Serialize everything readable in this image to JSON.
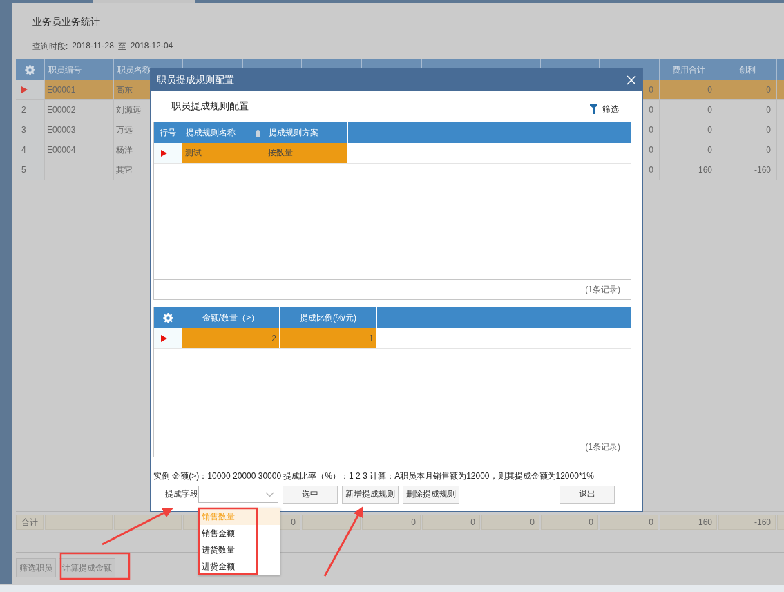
{
  "page": {
    "title": "业务员业务统计",
    "query_label": "查询时段:",
    "date_from": "2018-11-28",
    "date_sep": "至",
    "date_to": "2018-12-04"
  },
  "staff_table": {
    "columns": {
      "code": "职员编号",
      "name": "职员名称",
      "tail": [
        "费用合计",
        "创利"
      ]
    },
    "rows": [
      {
        "selected": true,
        "code": "E00001",
        "name": "高东",
        "values": [
          "0",
          "0",
          "0"
        ]
      },
      {
        "selected": false,
        "number": "2",
        "code": "E00002",
        "name": "刘源远",
        "values": [
          "0",
          "0",
          "0"
        ]
      },
      {
        "selected": false,
        "number": "3",
        "code": "E00003",
        "name": "万远",
        "values": [
          "0",
          "0",
          "0"
        ]
      },
      {
        "selected": false,
        "number": "4",
        "code": "E00004",
        "name": "杨洋",
        "values": [
          "0",
          "0",
          "0"
        ]
      },
      {
        "selected": false,
        "number": "5",
        "name": "其它",
        "values": [
          "0",
          "160",
          "-160"
        ]
      }
    ],
    "totals": {
      "label": "合计",
      "cells": [
        {},
        {},
        {},
        {
          "value": "0"
        },
        {},
        {
          "value": "0"
        },
        {
          "value": "0"
        },
        {
          "value": "0"
        },
        {
          "value": "0"
        },
        {
          "value": "0"
        },
        {
          "value": "160"
        },
        {
          "value": "-160"
        },
        {}
      ]
    }
  },
  "bottom_buttons": [
    "筛选职员",
    "计算提成金额"
  ],
  "dialog": {
    "title": "职员提成规则配置",
    "heading": "职员提成规则配置",
    "filter": "筛选",
    "rules_grid": {
      "columns": [
        {
          "label": "行号",
          "locked": false
        },
        {
          "label": "提成规则名称",
          "locked": true
        },
        {
          "label": "提成规则方案",
          "locked": false
        }
      ],
      "rows": [
        {
          "selected": true,
          "cells": [
            "",
            "测试",
            "按数量"
          ]
        }
      ],
      "footer": "(1条记录)"
    },
    "tiers_grid": {
      "columns": [
        {
          "label": "金额/数量（>）"
        },
        {
          "label": "提成比例(%/元)"
        }
      ],
      "rows": [
        {
          "selected": true,
          "cells": [
            "2",
            "1"
          ]
        }
      ],
      "footer": "(1条记录)"
    },
    "example": "实例 金额(>)：10000 20000 30000 提成比率（%）：1 2 3 计算：A职员本月销售额为12000，则其提成金额为12000*1%",
    "field_label": "提成字段",
    "field_select": {
      "expanded": true,
      "options": [
        {
          "label": "销售数量",
          "selected": true
        },
        {
          "label": "销售金额",
          "selected": false
        },
        {
          "label": "进货数量",
          "selected": false
        },
        {
          "label": "进货金额",
          "selected": false
        }
      ]
    },
    "buttons": [
      "选中",
      "新增提成规则",
      "删除提成规则",
      "退出"
    ]
  }
}
